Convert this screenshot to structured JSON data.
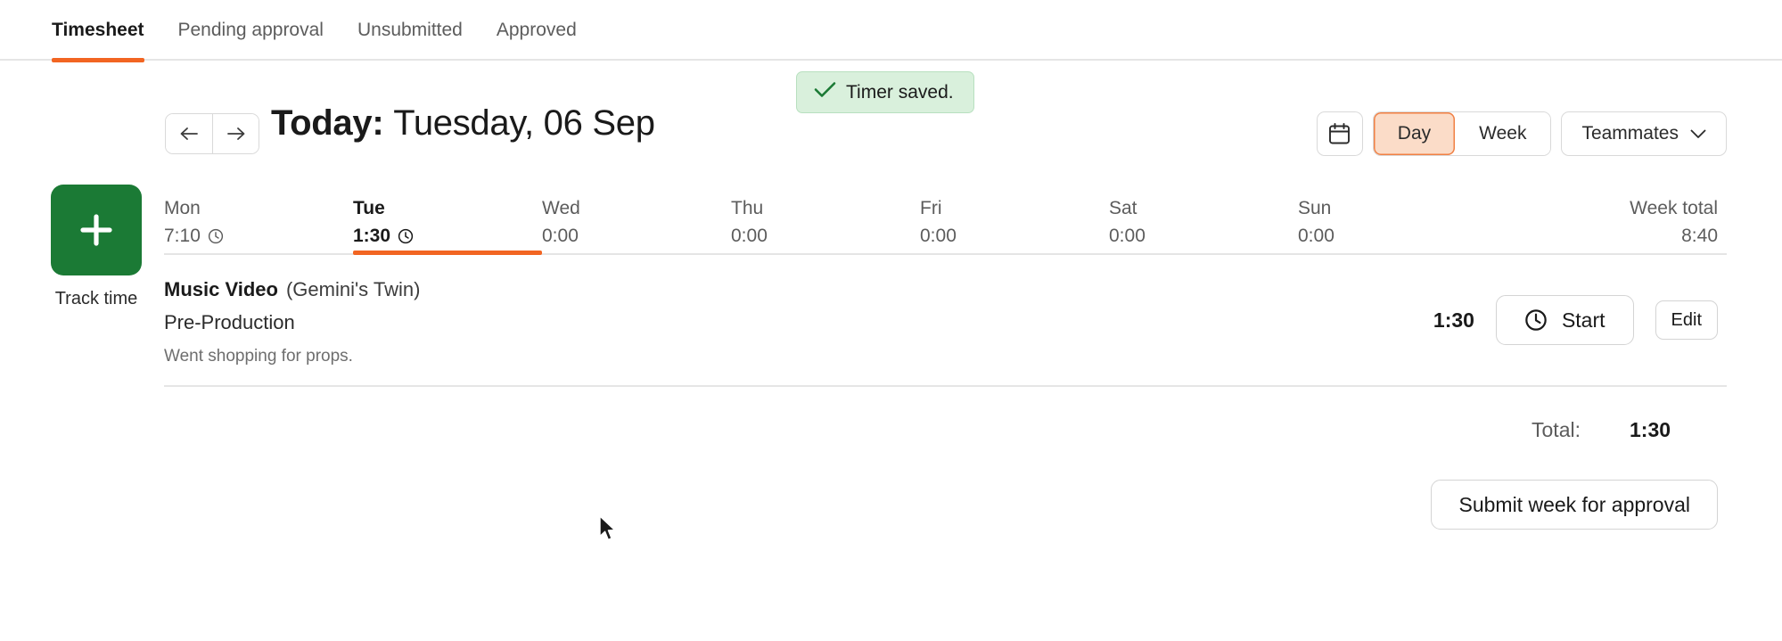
{
  "tabs": [
    {
      "label": "Timesheet",
      "active": true
    },
    {
      "label": "Pending approval",
      "active": false
    },
    {
      "label": "Unsubmitted",
      "active": false
    },
    {
      "label": "Approved",
      "active": false
    }
  ],
  "toast": {
    "message": "Timer saved.",
    "icon": "check-icon",
    "bg_color": "#d9f0dc",
    "icon_color": "#1b7a35"
  },
  "header": {
    "prev_label": "←",
    "next_label": "→",
    "title_prefix": "Today:",
    "title_date": "Tuesday, 06 Sep",
    "calendar_icon": "calendar-icon",
    "view_options": [
      {
        "label": "Day",
        "selected": true
      },
      {
        "label": "Week",
        "selected": false
      }
    ],
    "teammates_label": "Teammates",
    "teammates_caret": "chevron-down-icon",
    "accent_color": "#f26522",
    "selected_bg": "#fbdcc8"
  },
  "track_time": {
    "icon": "plus-icon",
    "label": "Track time",
    "color": "#1b7a35"
  },
  "week": {
    "days": [
      {
        "name": "Mon",
        "time": "7:10",
        "has_clock": true,
        "active": false
      },
      {
        "name": "Tue",
        "time": "1:30",
        "has_clock": true,
        "active": true
      },
      {
        "name": "Wed",
        "time": "0:00",
        "has_clock": false,
        "active": false
      },
      {
        "name": "Thu",
        "time": "0:00",
        "has_clock": false,
        "active": false
      },
      {
        "name": "Fri",
        "time": "0:00",
        "has_clock": false,
        "active": false
      },
      {
        "name": "Sat",
        "time": "0:00",
        "has_clock": false,
        "active": false
      },
      {
        "name": "Sun",
        "time": "0:00",
        "has_clock": false,
        "active": false
      }
    ],
    "total_label": "Week total",
    "total_value": "8:40"
  },
  "entries": [
    {
      "project": "Music Video",
      "client": "(Gemini's Twin)",
      "task": "Pre-Production",
      "note": "Went shopping for props.",
      "duration": "1:30",
      "start_label": "Start",
      "start_icon": "clock-icon",
      "edit_label": "Edit"
    }
  ],
  "footer": {
    "total_label": "Total:",
    "total_value": "1:30",
    "submit_label": "Submit week for approval"
  }
}
